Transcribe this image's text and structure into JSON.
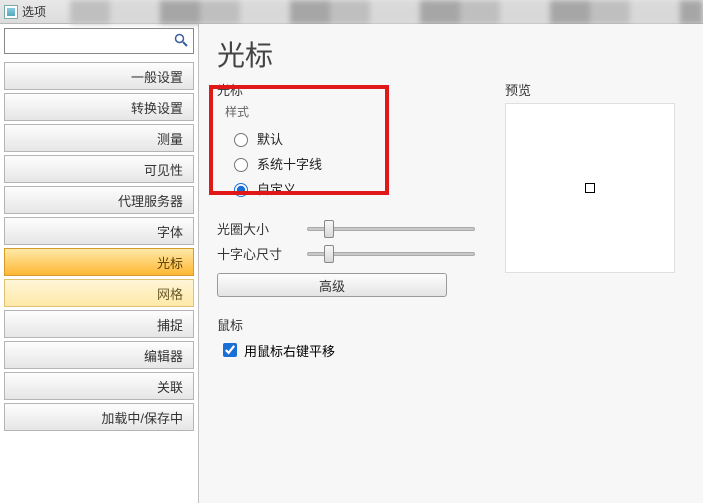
{
  "window": {
    "title": "选项"
  },
  "sidebar": {
    "search_placeholder": "",
    "items": [
      {
        "label": "一般设置"
      },
      {
        "label": "转换设置"
      },
      {
        "label": "测量"
      },
      {
        "label": "可见性"
      },
      {
        "label": "代理服务器"
      },
      {
        "label": "字体"
      },
      {
        "label": "光标",
        "active": true
      },
      {
        "label": "网格",
        "secondary": true
      },
      {
        "label": "捕捉"
      },
      {
        "label": "编辑器"
      },
      {
        "label": "关联"
      },
      {
        "label": "加载中/保存中"
      }
    ]
  },
  "page": {
    "title": "光标",
    "cursor_group": {
      "legend": "光标",
      "style_legend": "样式",
      "radios": {
        "default": "默认",
        "system_cross": "系统十字线",
        "custom": "自定义"
      },
      "selected": "custom",
      "aperture_label": "光圈大小",
      "aperture_value": 10,
      "crosshair_label": "十字心尺寸",
      "crosshair_value": 10,
      "advanced_btn": "高级"
    },
    "preview": {
      "legend": "预览"
    },
    "mouse_group": {
      "legend": "鼠标",
      "pan_checkbox_label": "用鼠标右键平移",
      "pan_checked": true
    }
  }
}
